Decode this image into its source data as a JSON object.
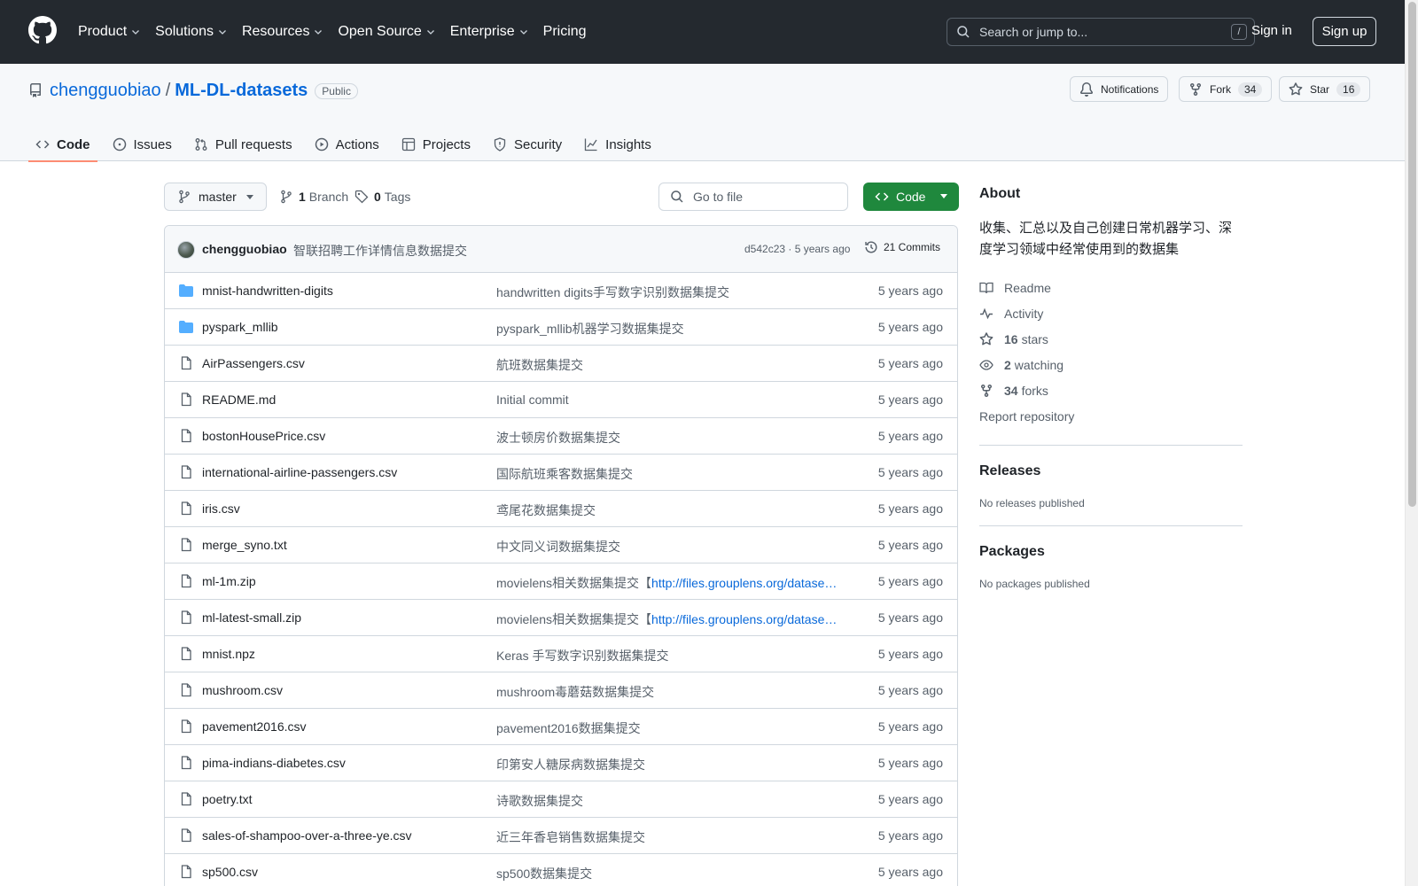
{
  "header": {
    "nav": [
      "Product",
      "Solutions",
      "Resources",
      "Open Source",
      "Enterprise",
      "Pricing"
    ],
    "search_placeholder": "Search or jump to...",
    "search_shortcut": "/",
    "signin": "Sign in",
    "signup": "Sign up"
  },
  "repo": {
    "owner": "chengguobiao",
    "separator": "/",
    "name": "ML-DL-datasets",
    "visibility": "Public",
    "notifications_label": "Notifications",
    "fork_label": "Fork",
    "fork_count": "34",
    "star_label": "Star",
    "star_count": "16"
  },
  "tabs": [
    "Code",
    "Issues",
    "Pull requests",
    "Actions",
    "Projects",
    "Security",
    "Insights"
  ],
  "toolbar": {
    "branch": "master",
    "branch_count": "1",
    "branch_label": "Branch",
    "tag_count": "0",
    "tag_label": "Tags",
    "gofile_placeholder": "Go to file",
    "code_label": "Code"
  },
  "commit": {
    "author": "chengguobiao",
    "message": "智联招聘工作详情信息数据提交",
    "hash": "d542c23 · 5 years ago",
    "commits": "21 Commits"
  },
  "files": [
    {
      "type": "dir",
      "name": "mnist-handwritten-digits",
      "msg": "handwritten digits手写数字识别数据集提交",
      "link": "",
      "age": "5 years ago"
    },
    {
      "type": "dir",
      "name": "pyspark_mllib",
      "msg": "pyspark_mllib机器学习数据集提交",
      "link": "",
      "age": "5 years ago"
    },
    {
      "type": "file",
      "name": "AirPassengers.csv",
      "msg": "航班数据集提交",
      "link": "",
      "age": "5 years ago"
    },
    {
      "type": "file",
      "name": "README.md",
      "msg": "Initial commit",
      "link": "",
      "age": "5 years ago"
    },
    {
      "type": "file",
      "name": "bostonHousePrice.csv",
      "msg": "波士顿房价数据集提交",
      "link": "",
      "age": "5 years ago"
    },
    {
      "type": "file",
      "name": "international-airline-passengers.csv",
      "msg": "国际航班乘客数据集提交",
      "link": "",
      "age": "5 years ago"
    },
    {
      "type": "file",
      "name": "iris.csv",
      "msg": "鸢尾花数据集提交",
      "link": "",
      "age": "5 years ago"
    },
    {
      "type": "file",
      "name": "merge_syno.txt",
      "msg": "中文同义词数据集提交",
      "link": "",
      "age": "5 years ago"
    },
    {
      "type": "file",
      "name": "ml-1m.zip",
      "msg": "movielens相关数据集提交【",
      "link": "http://files.grouplens.org/datase…",
      "age": "5 years ago"
    },
    {
      "type": "file",
      "name": "ml-latest-small.zip",
      "msg": "movielens相关数据集提交【",
      "link": "http://files.grouplens.org/datase…",
      "age": "5 years ago"
    },
    {
      "type": "file",
      "name": "mnist.npz",
      "msg": "Keras 手写数字识别数据集提交",
      "link": "",
      "age": "5 years ago"
    },
    {
      "type": "file",
      "name": "mushroom.csv",
      "msg": "mushroom毒蘑菇数据集提交",
      "link": "",
      "age": "5 years ago"
    },
    {
      "type": "file",
      "name": "pavement2016.csv",
      "msg": "pavement2016数据集提交",
      "link": "",
      "age": "5 years ago"
    },
    {
      "type": "file",
      "name": "pima-indians-diabetes.csv",
      "msg": "印第安人糖尿病数据集提交",
      "link": "",
      "age": "5 years ago"
    },
    {
      "type": "file",
      "name": "poetry.txt",
      "msg": "诗歌数据集提交",
      "link": "",
      "age": "5 years ago"
    },
    {
      "type": "file",
      "name": "sales-of-shampoo-over-a-three-ye.csv",
      "msg": "近三年香皂销售数据集提交",
      "link": "",
      "age": "5 years ago"
    },
    {
      "type": "file",
      "name": "sp500.csv",
      "msg": "sp500数据集提交",
      "link": "",
      "age": "5 years ago"
    }
  ],
  "about": {
    "title": "About",
    "description": "收集、汇总以及自己创建日常机器学习、深度学习领域中经常使用到的数据集",
    "readme": "Readme",
    "activity": "Activity",
    "stars_count": "16",
    "stars_label": "stars",
    "watching_count": "2",
    "watching_label": "watching",
    "forks_count": "34",
    "forks_label": "forks",
    "report": "Report repository"
  },
  "releases": {
    "title": "Releases",
    "text": "No releases published"
  },
  "packages": {
    "title": "Packages",
    "text": "No packages published"
  }
}
